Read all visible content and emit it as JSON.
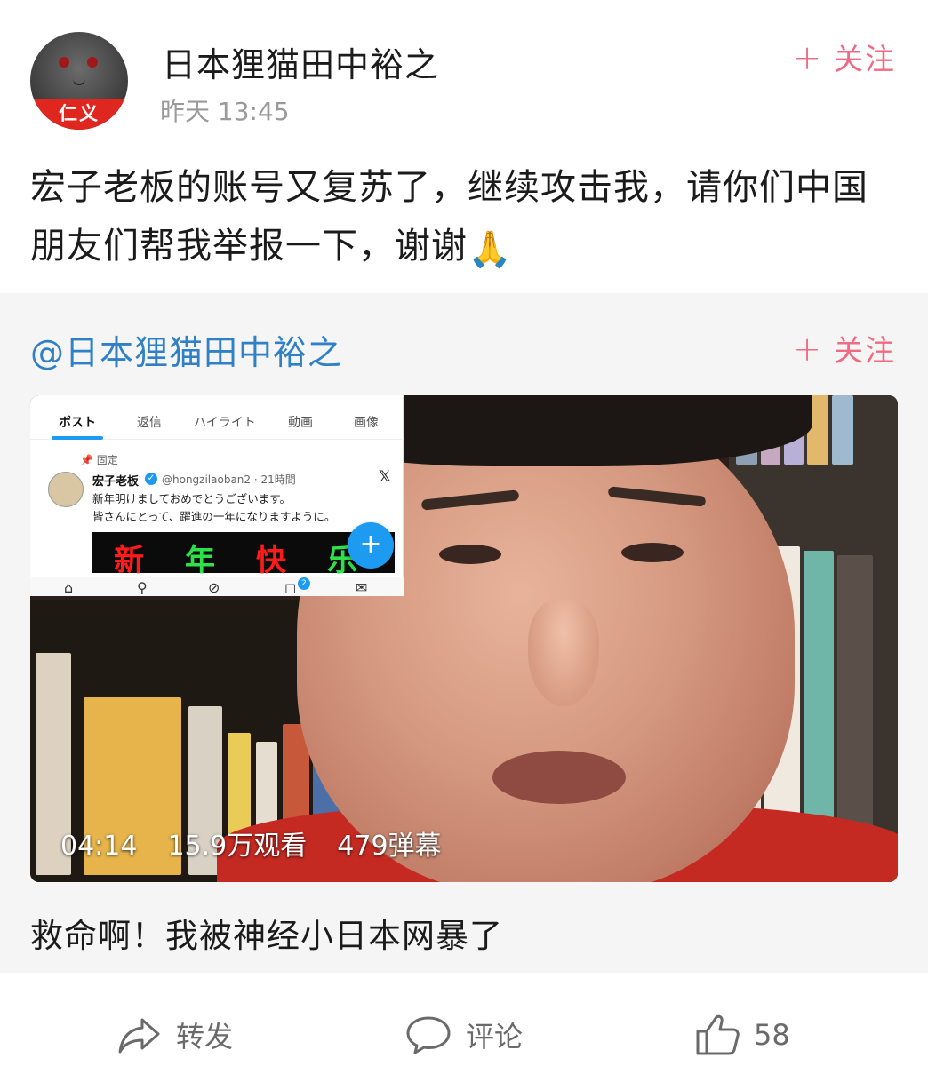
{
  "post": {
    "username": "日本狸猫田中裕之",
    "avatar_badge": "仁义",
    "timestamp": "昨天 13:45",
    "follow_plus": "+",
    "follow_label": "关注",
    "text": "宏子老板的账号又复苏了，继续攻击我，请你们中国朋友们帮我举报一下，谢谢",
    "emoji": "🙏"
  },
  "repost": {
    "author": "@日本狸猫田中裕之",
    "follow_plus": "+",
    "follow_label": "关注",
    "video": {
      "duration": "04:14",
      "views": "15.9万观看",
      "danmaku": "479弹幕",
      "inset": {
        "tabs": [
          "ポスト",
          "返信",
          "ハイライト",
          "動画",
          "画像"
        ],
        "pinned": "固定",
        "name": "宏子老板",
        "handle": "@hongzilaoban2 · 21時間",
        "line1": "新年明けましておめでとうございます。",
        "line2": "皆さんにとって、躍進の一年になりますように。",
        "image_text": "新年快乐",
        "notification_count": "2"
      }
    },
    "title": "救命啊！我被神经小日本网暴了"
  },
  "footer": {
    "share_label": "转发",
    "comment_label": "评论",
    "like_count": "58"
  },
  "colors": {
    "follow": "#ef6b84",
    "mention": "#2f80c7",
    "repost_bg": "#f5f5f5",
    "badge_red": "#e0271f"
  },
  "icons": {
    "share": "share-arrow-icon",
    "comment": "comment-bubble-icon",
    "like": "thumbs-up-icon",
    "verified": "verified-badge-icon"
  }
}
